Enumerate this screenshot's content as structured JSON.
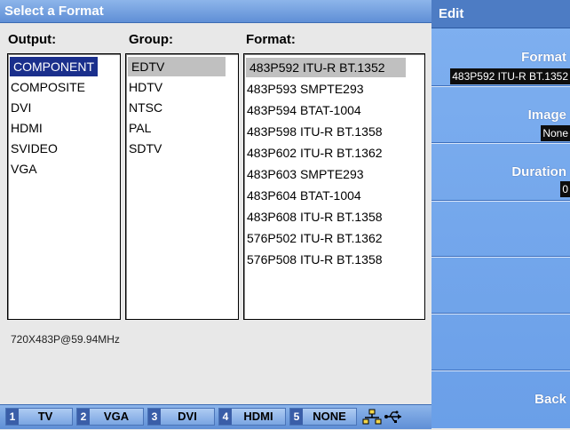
{
  "title": "Select a Format",
  "columns": {
    "output": "Output:",
    "group": "Group:",
    "format": "Format:"
  },
  "output_items": [
    "COMPONENT",
    "COMPOSITE",
    "DVI",
    "HDMI",
    "SVIDEO",
    "VGA"
  ],
  "group_items": [
    "EDTV",
    "HDTV",
    "NTSC",
    "PAL",
    "SDTV"
  ],
  "format_items": [
    "483P592 ITU-R BT.1352",
    "483P593 SMPTE293",
    "483P594 BTAT-1004",
    "483P598 ITU-R BT.1358",
    "483P602 ITU-R BT.1362",
    "483P603 SMPTE293",
    "483P604 BTAT-1004",
    "483P608 ITU-R BT.1358",
    "576P502 ITU-R BT.1362",
    "576P508 ITU-R BT.1358"
  ],
  "status_text": "720X483P@59.94MHz",
  "tabs": [
    {
      "num": "1",
      "label": "TV"
    },
    {
      "num": "2",
      "label": "VGA"
    },
    {
      "num": "3",
      "label": "DVI"
    },
    {
      "num": "4",
      "label": "HDMI"
    },
    {
      "num": "5",
      "label": "NONE"
    }
  ],
  "edit_panel": {
    "title": "Edit",
    "format_label": "Format",
    "format_value": "483P592 ITU-R BT.1352",
    "image_label": "Image",
    "image_value": "None",
    "duration_label": "Duration",
    "duration_value": "0",
    "back_label": "Back"
  },
  "colors": {
    "accent": "#5f8fd6",
    "selection": "#1a2f8c",
    "panel": "#7fb0f0"
  }
}
